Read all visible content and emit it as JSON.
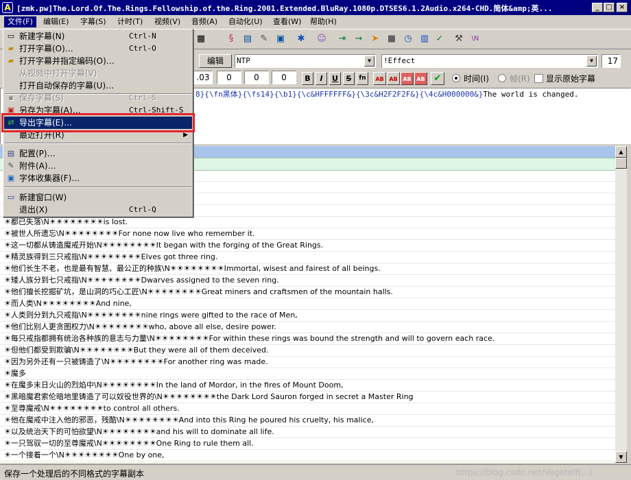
{
  "window": {
    "title": "[zmk.pw]The.Lord.Of.The.Rings.Fellowship.of.the.Ring.2001.Extended.BluRay.1080p.DTSES6.1.2Audio.x264-CHD.简体&amp;英...",
    "minimize": "_",
    "maximize": "□",
    "close": "×"
  },
  "menubar": [
    {
      "label": "文件(F)"
    },
    {
      "label": "编辑(E)"
    },
    {
      "label": "字幕(S)"
    },
    {
      "label": "计时(T)"
    },
    {
      "label": "视频(V)"
    },
    {
      "label": "音频(A)"
    },
    {
      "label": "自动化(U)"
    },
    {
      "label": "查看(W)"
    },
    {
      "label": "帮助(H)"
    }
  ],
  "file_menu": [
    {
      "label": "新建字幕(N)",
      "shortcut": "Ctrl-N",
      "icon": "new-file-icon",
      "state": "normal"
    },
    {
      "label": "打开字幕(O)…",
      "shortcut": "Ctrl-O",
      "icon": "open-folder-icon",
      "state": "normal"
    },
    {
      "label": "打开字幕并指定编码(O)…",
      "shortcut": "",
      "icon": "open-folder-icon",
      "state": "normal"
    },
    {
      "label": "从视频中打开字幕(V)",
      "shortcut": "",
      "icon": "",
      "state": "disabled"
    },
    {
      "label": "打开自动保存的字幕(U)…",
      "shortcut": "",
      "icon": "",
      "state": "normal"
    },
    {
      "label": "保存字幕(S)",
      "shortcut": "Ctrl-S",
      "icon": "save-disk-icon",
      "state": "disabled"
    },
    {
      "label": "另存为字幕(A)…",
      "shortcut": "Ctrl-Shift-S",
      "icon": "save-as-icon",
      "state": "normal"
    },
    {
      "label": "导出字幕(E)…",
      "shortcut": "",
      "icon": "export-icon",
      "state": "highlight"
    },
    {
      "label": "最近打开(R)",
      "shortcut": "",
      "icon": "",
      "state": "submenu"
    },
    {
      "label": "配置(P)…",
      "shortcut": "",
      "icon": "properties-icon",
      "state": "normal"
    },
    {
      "label": "附件(A)…",
      "shortcut": "",
      "icon": "attachment-icon",
      "state": "normal"
    },
    {
      "label": "字体收集器(F)…",
      "shortcut": "",
      "icon": "font-collector-icon",
      "state": "normal"
    },
    {
      "label": "新建窗口(W)",
      "shortcut": "",
      "icon": "new-window-icon",
      "state": "normal"
    },
    {
      "label": "退出(X)",
      "shortcut": "Ctrl-Q",
      "icon": "",
      "state": "normal"
    }
  ],
  "edit": {
    "button_label": "编辑",
    "actor_value": "NTP",
    "effect_value": "!Effect",
    "layer_value": "17",
    "end_time_partial": ".03",
    "margin_l": "0",
    "margin_r": "0",
    "margin_v": "0",
    "bold": "B",
    "italic": "I",
    "underline": "U",
    "strike": "S",
    "font": "fn",
    "color_label": "AB",
    "commit": "✔",
    "time_label": "时间(I)",
    "frame_label": "帧(R)",
    "show_original_label": "显示原始字幕",
    "text_segments": [
      {
        "text": "8}",
        "kind": "tag"
      },
      {
        "text": "{\\fn黑体}",
        "kind": "tag"
      },
      {
        "text": "{\\fs14}",
        "kind": "tag"
      },
      {
        "text": "{\\b1}",
        "kind": "tag"
      },
      {
        "text": "{\\c&HFFFFFF&}",
        "kind": "tag"
      },
      {
        "text": "{\\3c&H2F2F2F&}",
        "kind": "tag"
      },
      {
        "text": "{\\4c&H000000&}",
        "kind": "tag"
      },
      {
        "text": "The world is changed.",
        "kind": "text"
      }
    ]
  },
  "rows": [
    {
      "text": "nged.",
      "state": "selected"
    },
    {
      "text": "ter.",
      "state": "normal"
    },
    {
      "text": "earth.",
      "state": "normal"
    },
    {
      "text": "r.",
      "state": "normal"
    },
    {
      "text": "",
      "state": "normal"
    },
    {
      "text": "☀都已失落\\N☀☀☀☀☀☀☀☀is lost.",
      "state": "normal"
    },
    {
      "text": "☀被世人所遗忘\\N☀☀☀☀☀☀☀☀For none now live who remember it.",
      "state": "normal"
    },
    {
      "text": "☀这一切都从铸造魔戒开始\\N☀☀☀☀☀☀☀☀It began with the forging of the Great Rings.",
      "state": "normal"
    },
    {
      "text": "☀精灵族得到三只戒指\\N☀☀☀☀☀☀☀☀Elves got three ring.",
      "state": "normal"
    },
    {
      "text": "☀他们长生不老，也是最有智慧、最公正的种族\\N☀☀☀☀☀☀☀☀Immortal, wisest and fairest of all beings.",
      "state": "normal"
    },
    {
      "text": "☀矮人族分到七只戒指\\N☀☀☀☀☀☀☀☀Dwarves assigned to the seven ring.",
      "state": "normal"
    },
    {
      "text": "☀他们擅长挖掘矿坑，是山洞的巧心工匠\\N☀☀☀☀☀☀☀☀Great miners and craftsmen of the mountain halls.",
      "state": "normal"
    },
    {
      "text": "☀而人类\\N☀☀☀☀☀☀☀☀And nine,",
      "state": "normal"
    },
    {
      "text": "☀人类则分到九只戒指\\N☀☀☀☀☀☀☀☀nine rings were gifted to the race of Men,",
      "state": "normal"
    },
    {
      "text": "☀他们比别人更贪图权力\\N☀☀☀☀☀☀☀☀who, above all else, desire power.",
      "state": "normal"
    },
    {
      "text": "☀每只戒指都拥有统治各种族的意志与力量\\N☀☀☀☀☀☀☀☀For within these rings was bound the strength and will to govern each race.",
      "state": "normal"
    },
    {
      "text": "☀但他们都受到欺骗\\N☀☀☀☀☀☀☀☀But they were all of them deceived.",
      "state": "normal"
    },
    {
      "text": "☀因为另外还有一只被铸造了\\N☀☀☀☀☀☀☀☀For another ring was made.",
      "state": "normal"
    },
    {
      "text": "☀魔多",
      "state": "normal"
    },
    {
      "text": "☀在魔多末日火山的烈焰中\\N☀☀☀☀☀☀☀☀In the land of Mordor, in the fires of Mount Doom,",
      "state": "normal"
    },
    {
      "text": "☀黑暗魔君索伦暗地里铸造了可以奴役世界的\\N☀☀☀☀☀☀☀☀the Dark Lord Sauron forged in secret a Master Ring",
      "state": "normal"
    },
    {
      "text": "☀至尊魔戒\\N☀☀☀☀☀☀☀☀to control all others.",
      "state": "normal"
    },
    {
      "text": "☀他在魔戒中注入他的邪恶，残酷\\N☀☀☀☀☀☀☀☀And into this Ring he poured his cruelty, his malice,",
      "state": "normal"
    },
    {
      "text": "☀以及统治天下的可怕欲望\\N☀☀☀☀☀☀☀☀and his will to dominate all life.",
      "state": "normal"
    },
    {
      "text": "☀一只驾驭一切的至尊魔戒\\N☀☀☀☀☀☀☀☀One Ring to rule them all.",
      "state": "normal"
    },
    {
      "text": "☀一个接着一个\\N☀☀☀☀☀☀☀☀One by one,",
      "state": "normal"
    }
  ],
  "scroll": {
    "up": "▲",
    "down": "▼"
  },
  "status": {
    "text": "保存一个处理后的不同格式的字幕副本",
    "watermark": "https://blog.csdn.net/Vegetelf(...)"
  },
  "colors": {
    "title_bar": "#000080",
    "menu_highlight": "#0a246a",
    "annotation_box": "#e3242b",
    "selected_row": "#ddf6e6",
    "override_tag": "#1a33b0"
  }
}
